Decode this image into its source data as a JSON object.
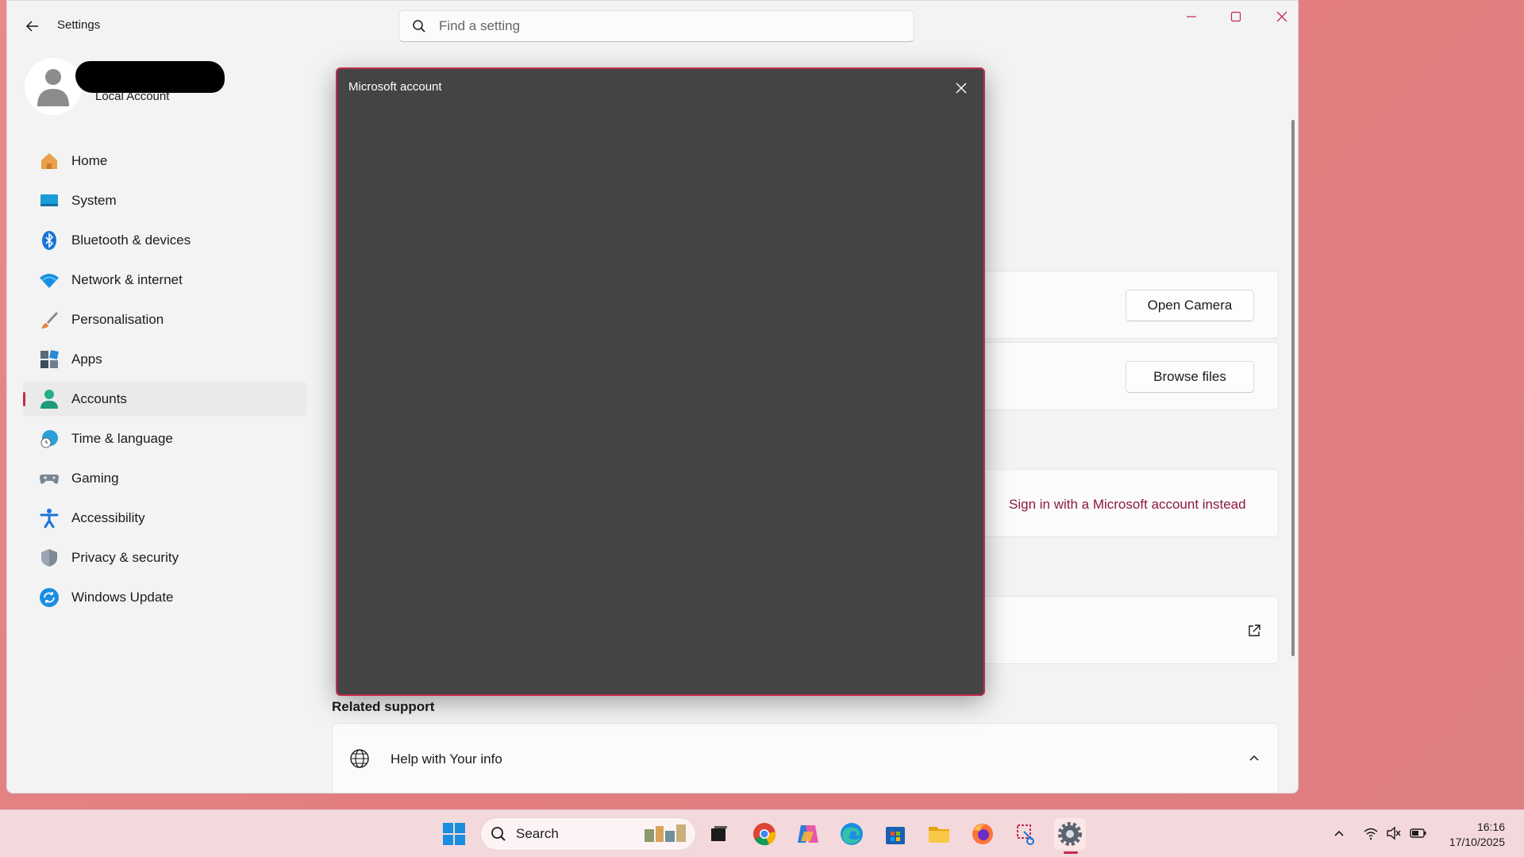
{
  "window": {
    "app_title": "Settings",
    "search_placeholder": "Find a setting"
  },
  "profile": {
    "account_type": "Local Account"
  },
  "sidebar": {
    "items": [
      {
        "label": "Home",
        "icon": "home-icon"
      },
      {
        "label": "System",
        "icon": "system-icon"
      },
      {
        "label": "Bluetooth & devices",
        "icon": "bluetooth-icon"
      },
      {
        "label": "Network & internet",
        "icon": "wifi-icon"
      },
      {
        "label": "Personalisation",
        "icon": "brush-icon"
      },
      {
        "label": "Apps",
        "icon": "apps-icon"
      },
      {
        "label": "Accounts",
        "icon": "accounts-icon",
        "active": true
      },
      {
        "label": "Time & language",
        "icon": "globe-clock-icon"
      },
      {
        "label": "Gaming",
        "icon": "gamepad-icon"
      },
      {
        "label": "Accessibility",
        "icon": "accessibility-icon"
      },
      {
        "label": "Privacy & security",
        "icon": "shield-icon"
      },
      {
        "label": "Windows Update",
        "icon": "update-icon"
      }
    ]
  },
  "content": {
    "open_camera_label": "Open Camera",
    "browse_files_label": "Browse files",
    "sign_in_link": "Sign in with a Microsoft account instead",
    "related_support_title": "Related support",
    "help_label": "Help with Your info"
  },
  "dialog": {
    "title": "Microsoft account"
  },
  "taskbar": {
    "search_label": "Search",
    "time": "16:16",
    "date": "17/10/2025"
  },
  "colors": {
    "accent": "#c42b4c",
    "link": "#8b1a3c",
    "dialog_bg": "#444444",
    "desktop_bg": "#e2848a"
  }
}
